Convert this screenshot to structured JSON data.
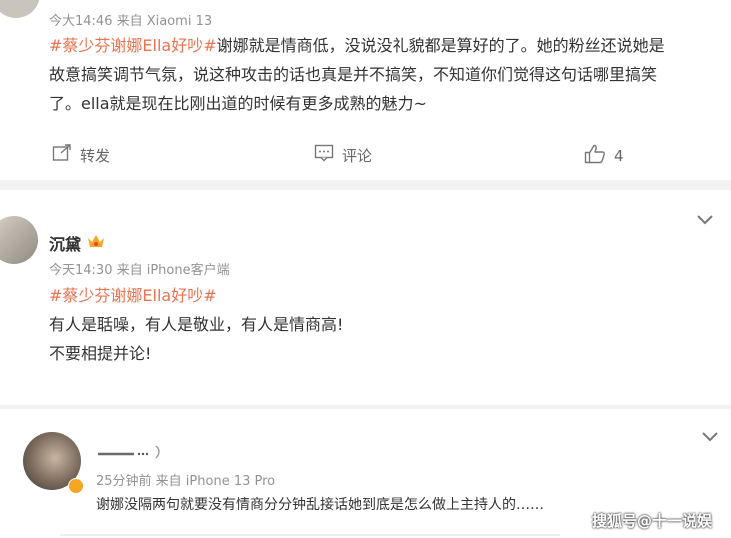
{
  "post1": {
    "meta": "今大14:46  来自 Xiaomi 13",
    "hashtag": "#蔡少芬谢娜Ella好吵#",
    "line1_text": "谢娜就是情商低，没说没礼貌都是算好的了。她的粉丝还说她是",
    "line2": "故意搞笑调节气氛，说这种攻击的话也真是并不搞笑，不知道你们觉得这句话哪里搞笑",
    "line3": "了。ella就是现在比刚出道的时候有更多成熟的魅力~",
    "actions": {
      "repost": "转发",
      "comment": "评论",
      "likes": "4"
    }
  },
  "post2": {
    "username": "沉黛",
    "meta": "今天14:30  来自 iPhone客户端",
    "hashtag": "#蔡少芬谢娜Ella好吵#",
    "line1": "有人是聒噪，有人是敬业，有人是情商高!",
    "line2": "不要相提并论!"
  },
  "post3": {
    "username": "",
    "meta": "25分钟前  来自 iPhone 13 Pro",
    "text": "谢娜没隔两句就要没有情商分分钟乱接话她到底是怎么做上主持人的……"
  },
  "watermark": "搜狐号@十一说娱",
  "icons": [
    "repost-icon",
    "comment-icon",
    "like-icon",
    "chevron-down-icon",
    "crown-badge-icon",
    "verified-badge-icon"
  ],
  "colors": {
    "hashtag": "#eb7350",
    "meta": "#939393",
    "divider": "#f2f2f2",
    "badge": "#f5a623"
  }
}
